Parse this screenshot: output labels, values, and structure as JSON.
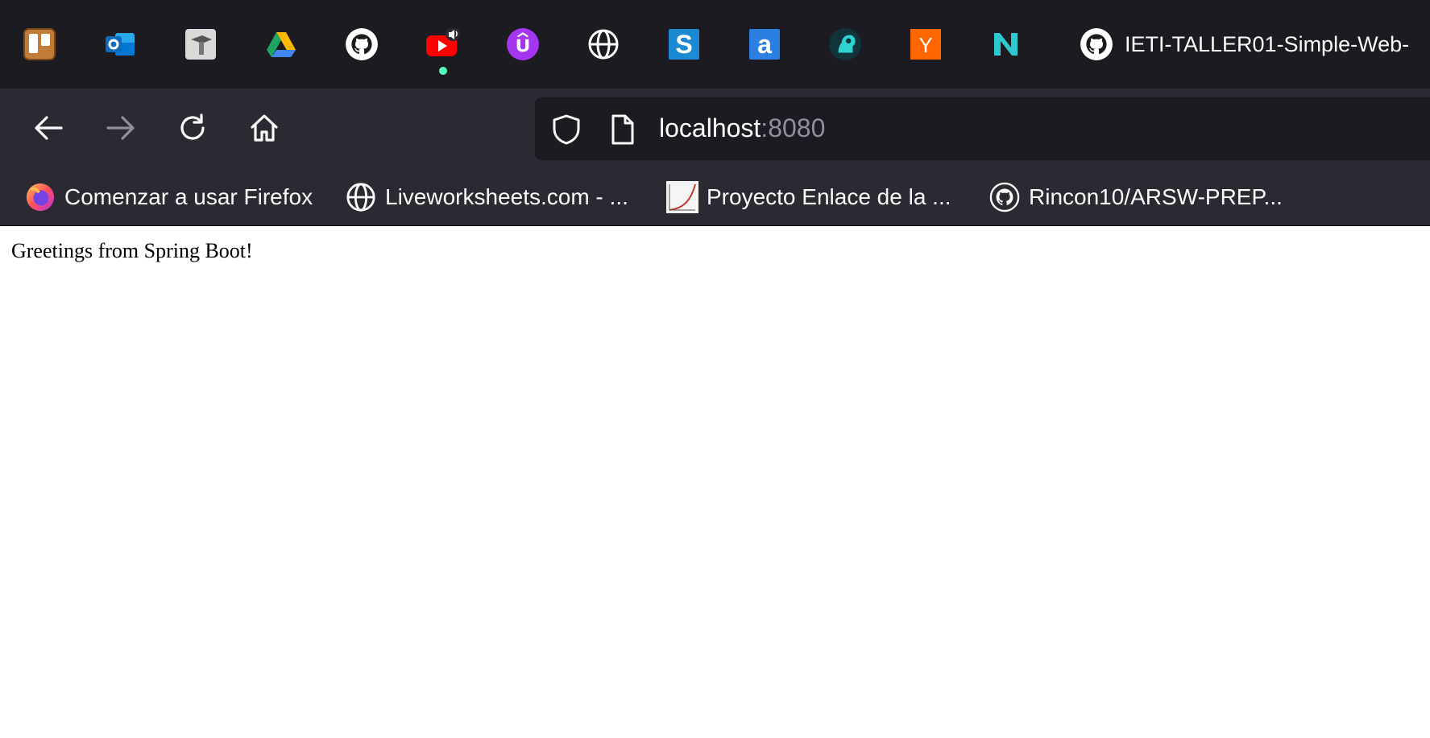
{
  "tab_strip": {
    "pinned_tabs": [
      {
        "icon": "trello-icon",
        "color": "#c27c3a"
      },
      {
        "icon": "outlook-icon",
        "color": "#0f6cbd"
      },
      {
        "icon": "classroom-icon",
        "color": "#d9d9d9"
      },
      {
        "icon": "google-drive-icon",
        "color": "#1fa463"
      },
      {
        "icon": "github-icon",
        "color": "#ffffff"
      },
      {
        "icon": "youtube-icon",
        "color": "#ff0000",
        "playing_audio": true
      },
      {
        "icon": "udemy-icon",
        "color": "#a435f0"
      },
      {
        "icon": "globe-icon",
        "color": "#ffffff"
      },
      {
        "icon": "s-app-icon",
        "color": "#1b8ad3"
      },
      {
        "icon": "a-app-icon",
        "color": "#2a7fe0"
      },
      {
        "icon": "head-profile-icon",
        "color": "#2fd1d1"
      },
      {
        "icon": "y-combinator-icon",
        "color": "#ff6600"
      },
      {
        "icon": "n-app-icon",
        "color": "#2ec8d0"
      }
    ],
    "active_tab": {
      "icon": "github-icon",
      "title": "IETI-TALLER01-Simple-Web-"
    }
  },
  "nav": {
    "back_icon": "back-arrow-icon",
    "forward_icon": "forward-arrow-icon",
    "reload_icon": "reload-icon",
    "home_icon": "home-icon",
    "url_host": "localhost",
    "url_port": ":8080"
  },
  "bookmarks": [
    {
      "icon": "firefox-icon",
      "label": "Comenzar a usar Firefox"
    },
    {
      "icon": "globe-icon",
      "label": "Liveworksheets.com - ..."
    },
    {
      "icon": "chart-thumbnail-icon",
      "label": "Proyecto Enlace de la ..."
    },
    {
      "icon": "github-icon",
      "label": "Rincon10/ARSW-PREP..."
    }
  ],
  "page": {
    "text": "Greetings from Spring Boot!"
  },
  "colors": {
    "tabstrip_bg": "#1c1b22",
    "toolbar_bg": "#2b2a33",
    "urlbar_bg": "#1c1b22",
    "text_light": "#fbfbfe",
    "text_muted": "#8f8f9d"
  }
}
